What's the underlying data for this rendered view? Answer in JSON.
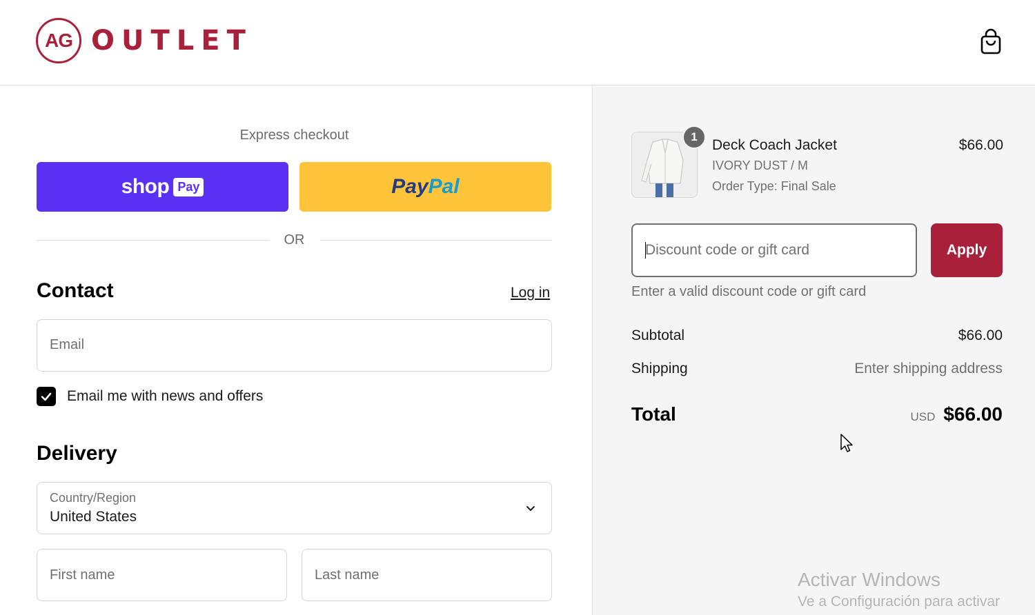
{
  "header": {
    "logo_mark": "AG",
    "logo_text": "OUTLET",
    "cart_icon": "shopping-bag-icon",
    "brand_color": "#a8203a"
  },
  "express": {
    "label": "Express checkout",
    "shop_pay_word": "shop",
    "shop_pay_badge": "Pay",
    "shop_pay_color": "#5a31f4",
    "paypal_part1": "Pay",
    "paypal_part2": "Pal",
    "paypal_color": "#ffc439",
    "or_text": "OR"
  },
  "contact": {
    "title": "Contact",
    "login_link": "Log in",
    "email_placeholder": "Email",
    "newsletter_label": "Email me with news and offers",
    "newsletter_checked": true
  },
  "delivery": {
    "title": "Delivery",
    "country_label": "Country/Region",
    "country_value": "United States",
    "first_name_placeholder": "First name",
    "last_name_placeholder": "Last name"
  },
  "order": {
    "item": {
      "quantity": "1",
      "name": "Deck Coach Jacket",
      "variant": "IVORY DUST / M",
      "order_type": "Order Type: Final Sale",
      "price": "$66.00"
    },
    "discount_placeholder": "Discount code or gift card",
    "apply_label": "Apply",
    "discount_help": "Enter a valid discount code or gift card",
    "subtotal_label": "Subtotal",
    "subtotal_value": "$66.00",
    "shipping_label": "Shipping",
    "shipping_value": "Enter shipping address",
    "total_label": "Total",
    "currency": "USD",
    "total_value": "$66.00"
  },
  "watermark": {
    "line1": "Activar Windows",
    "line2": "Ve a Configuración para activar"
  }
}
